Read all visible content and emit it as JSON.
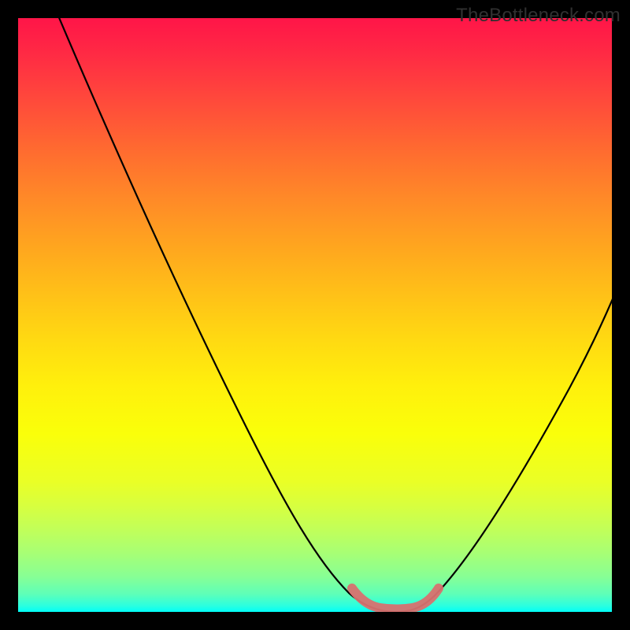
{
  "attribution": "TheBottleneck.com",
  "chart_data": {
    "type": "line",
    "title": "",
    "xlabel": "",
    "ylabel": "",
    "xlim": [
      0,
      100
    ],
    "ylim": [
      0,
      100
    ],
    "grid": false,
    "legend": false,
    "x": [
      0,
      5,
      10,
      15,
      20,
      25,
      30,
      35,
      40,
      45,
      50,
      55,
      60,
      62,
      65,
      68,
      70,
      75,
      80,
      85,
      90,
      95,
      100
    ],
    "values": [
      102,
      95,
      87,
      79,
      71,
      63,
      55,
      46,
      37,
      28,
      19,
      11,
      4,
      1,
      0,
      1,
      4,
      13,
      24,
      35,
      46,
      55,
      62
    ],
    "annotations": [
      {
        "label": "optimal-band",
        "x_range": [
          58,
          70
        ],
        "y": 0
      }
    ]
  }
}
